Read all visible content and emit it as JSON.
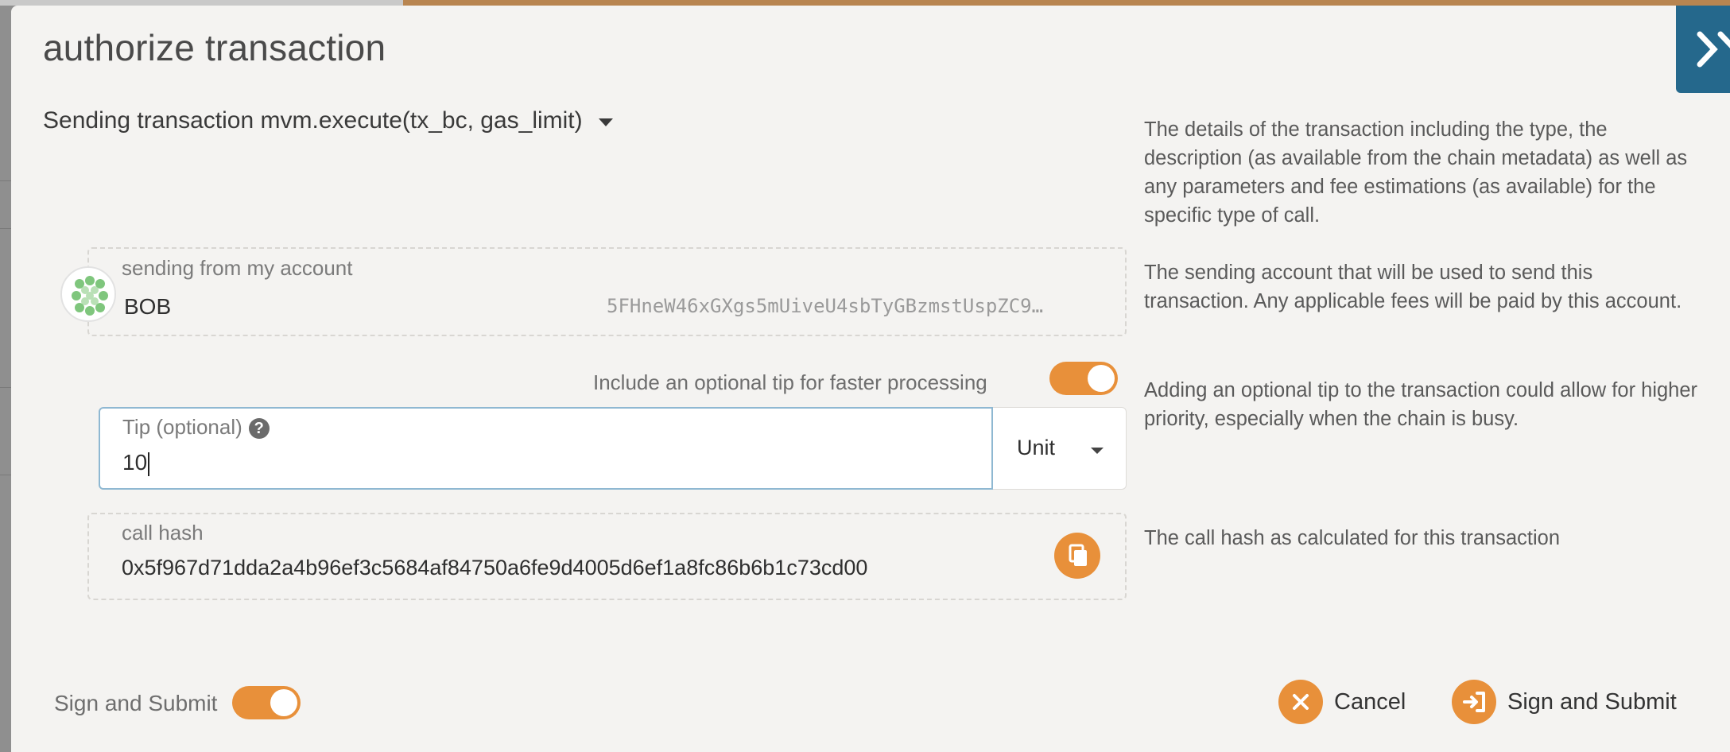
{
  "dialog": {
    "title": "authorize transaction",
    "heading": "Sending transaction mvm.execute(tx_bc, gas_limit)"
  },
  "help": {
    "details": "The details of the transaction including the type, the description (as available from the chain metadata) as well as any parameters and fee estimations (as available) for the specific type of call.",
    "account": "The sending account that will be used to send this transaction. Any applicable fees will be paid by this account.",
    "tip": "Adding an optional tip to the transaction could allow for higher priority, especially when the chain is busy.",
    "hash": "The call hash as calculated for this transaction"
  },
  "account": {
    "label": "sending from my account",
    "name": "BOB",
    "address": "5FHneW46xGXgs5mUiveU4sbTyGBzmstUspZC9…"
  },
  "tip_toggle": {
    "label": "Include an optional tip for faster processing",
    "on": true
  },
  "tip_field": {
    "label": "Tip (optional)",
    "value": "10",
    "unit": "Unit",
    "help_icon": "question-circle-icon"
  },
  "call_hash": {
    "label": "call hash",
    "value": "0x5f967d71dda2a4b96ef3c5684af84750a6fe9d4005d6ef1a8fc86b6b1c73cd00",
    "copy_icon": "copy-icon"
  },
  "footer": {
    "sign_toggle_label": "Sign and Submit",
    "sign_toggle_on": true,
    "cancel_label": "Cancel",
    "submit_label": "Sign and Submit"
  },
  "colors": {
    "accent": "#e8903a",
    "focus_border": "#8fb8d2",
    "corner_tab": "#25688c"
  }
}
